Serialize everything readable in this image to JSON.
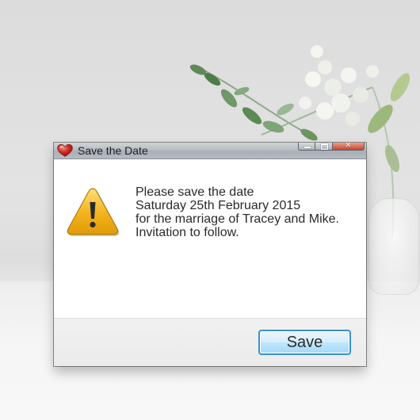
{
  "window": {
    "title": "Save the Date",
    "title_icon": "heart-icon",
    "controls": [
      "minimize-icon",
      "maximize-icon",
      "close-icon"
    ]
  },
  "dialog": {
    "icon": "warning-icon",
    "message_lines": [
      "Please save the date",
      "Saturday 25th February 2015",
      "for the marriage of Tracey and Mike.",
      "Invitation to follow."
    ]
  },
  "footer": {
    "save_label": "Save"
  },
  "colors": {
    "title_bar": "#b9bec5",
    "close_button": "#c9442b",
    "button_border": "#3c8fc8",
    "warning_fill": "#f2b31c",
    "heart": "#c8261e"
  }
}
